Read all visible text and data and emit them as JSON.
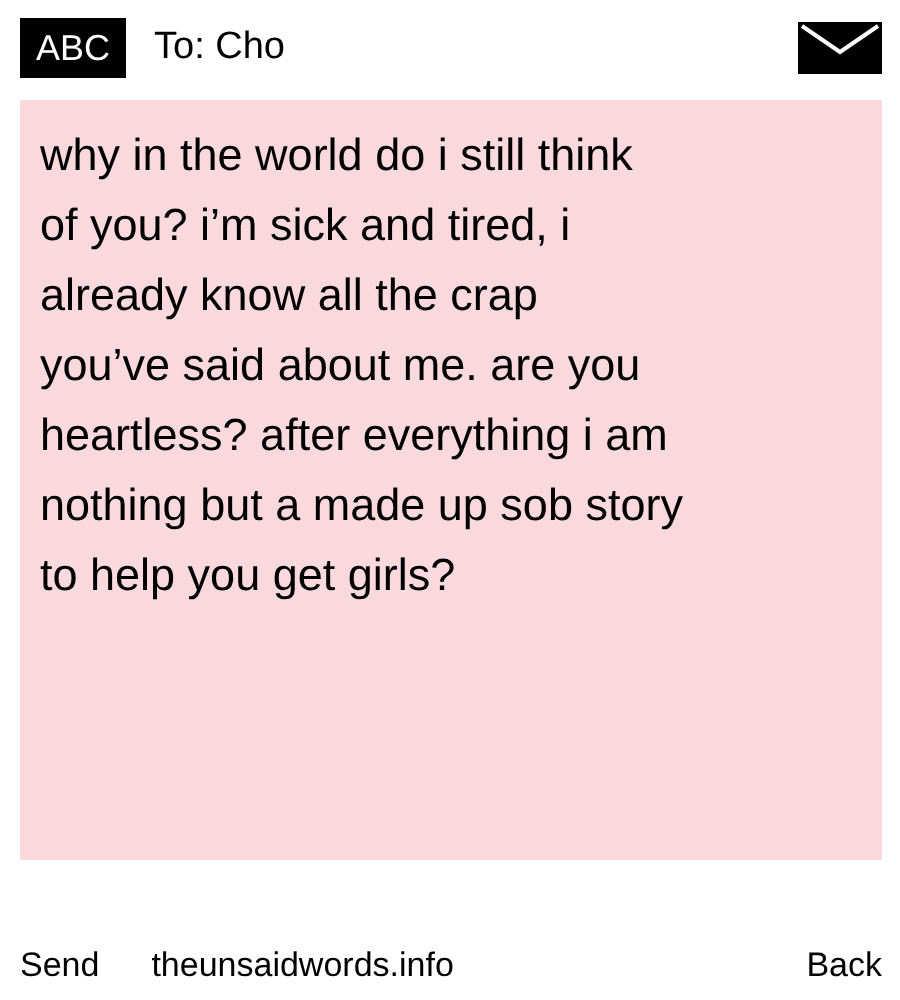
{
  "header": {
    "badge": "ABC",
    "recipient": "To: Cho"
  },
  "message": {
    "text": "why in the world do i still think\nof you? i’m sick and tired, i\nalready know all the crap\nyou’ve said about me. are you\nheartless? after everything i am\nnothing but a made up sob story\nto help you get girls?"
  },
  "footer": {
    "send": "Send",
    "site": "theunsaidwords.info",
    "back": "Back"
  }
}
